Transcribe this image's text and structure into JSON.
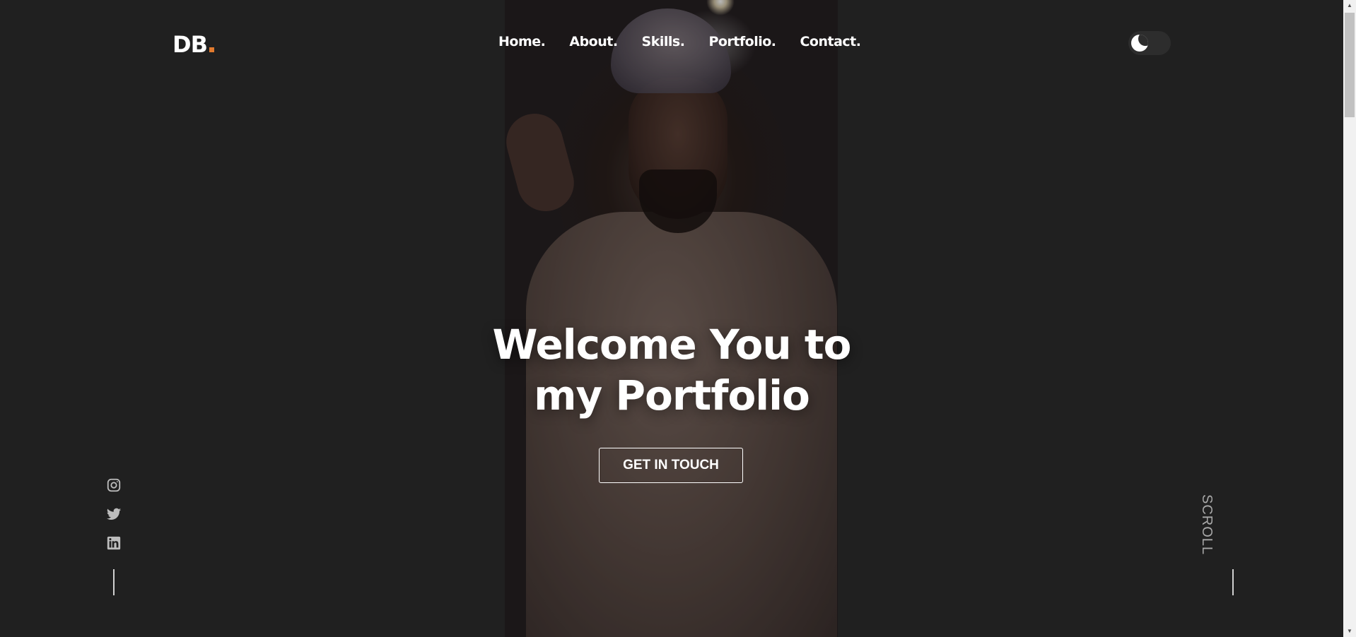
{
  "header": {
    "logo_text": "DB",
    "accent_color": "#e07a2e",
    "nav": [
      {
        "label": "Home."
      },
      {
        "label": "About."
      },
      {
        "label": "Skills."
      },
      {
        "label": "Portfolio."
      },
      {
        "label": "Contact."
      }
    ],
    "theme_toggle_icon": "moon-icon"
  },
  "hero": {
    "title_line1": "Welcome You to",
    "title_line2": "my Portfolio",
    "cta_label": "GET IN TOUCH"
  },
  "social": {
    "icons": [
      "instagram-icon",
      "twitter-icon",
      "linkedin-icon"
    ]
  },
  "scroll": {
    "label": "SCROLL"
  },
  "colors": {
    "background": "#202020",
    "text": "#ffffff",
    "muted": "#a8a8a8"
  }
}
